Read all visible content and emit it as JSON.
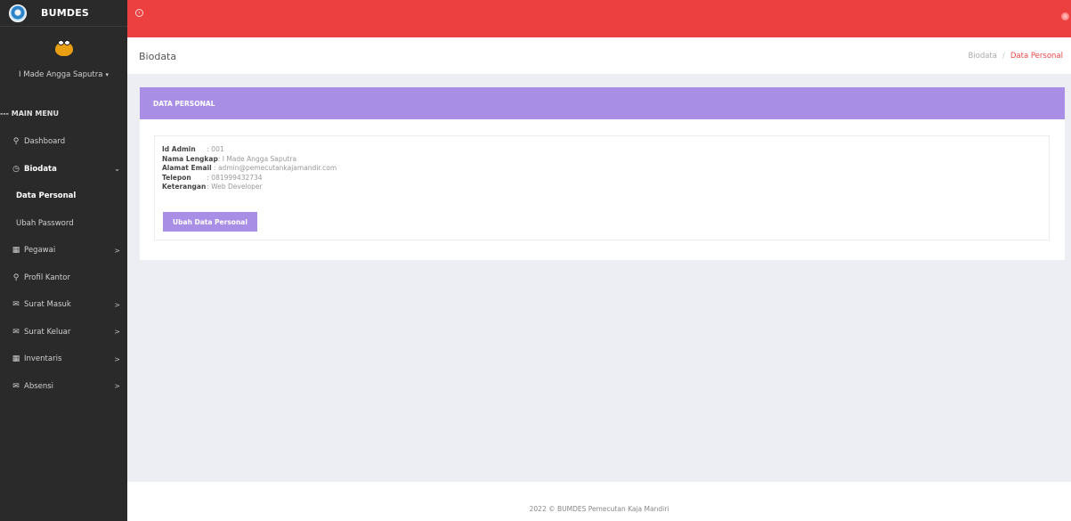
{
  "brand": {
    "name": "BUMDES"
  },
  "user": {
    "name": "I Made Angga Saputra",
    "caret": "▾"
  },
  "sidebar": {
    "header": "--- MAIN MENU",
    "items": [
      {
        "label": "Dashboard",
        "icon": "key-icon",
        "glyph": "⚲"
      },
      {
        "label": "Biodata",
        "icon": "clock-icon",
        "glyph": "◷",
        "arrow": "⌄"
      },
      {
        "label": "Data Personal"
      },
      {
        "label": "Ubah Password"
      },
      {
        "label": "Pegawai",
        "icon": "calendar-icon",
        "glyph": "▦",
        "arrow": ">"
      },
      {
        "label": "Profil Kantor",
        "icon": "key-icon",
        "glyph": "⚲"
      },
      {
        "label": "Surat Masuk",
        "icon": "envelope-icon",
        "glyph": "✉",
        "arrow": ">"
      },
      {
        "label": "Surat Keluar",
        "icon": "envelope-icon",
        "glyph": "✉",
        "arrow": ">"
      },
      {
        "label": "Inventaris",
        "icon": "calendar-icon",
        "glyph": "▦",
        "arrow": ">"
      },
      {
        "label": "Absensi",
        "icon": "envelope-icon",
        "glyph": "✉",
        "arrow": ">"
      }
    ]
  },
  "topbar": {
    "toggle_glyph": "‹"
  },
  "page": {
    "title": "Biodata"
  },
  "breadcrumb": {
    "parent": "Biodata",
    "separator": "/",
    "current": "Data Personal"
  },
  "card": {
    "title": "DATA PERSONAL",
    "fields": [
      {
        "label": "Id Admin",
        "value": ": 001"
      },
      {
        "label": "Nama Lengkap",
        "value": ": I Made Angga Saputra"
      },
      {
        "label": "Alamat Email",
        "value": ": admin@pemecutankajamandir.com"
      },
      {
        "label": "Telepon",
        "value": ": 081999432734"
      },
      {
        "label": "Keterangan",
        "value": ": Web Developer"
      }
    ],
    "button": "Ubah Data Personal"
  },
  "footer": {
    "text": "2022 © BUMDES Pemecutan Kaja Mandiri"
  },
  "colors": {
    "topbar": "#ec3f3f",
    "accent": "#a98ee6",
    "sidebar": "#2a2a2a",
    "breadcrumb_active": "#ec4747"
  }
}
